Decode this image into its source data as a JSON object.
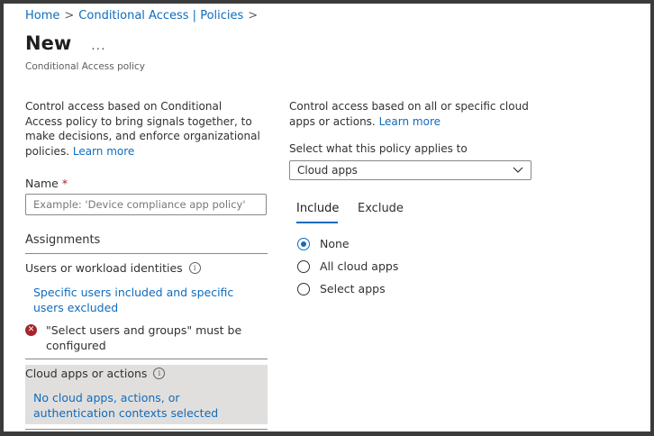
{
  "breadcrumb": {
    "home": "Home",
    "separator": ">",
    "section": "Conditional Access | Policies"
  },
  "header": {
    "title": "New",
    "more": "...",
    "subtitle": "Conditional Access policy"
  },
  "left": {
    "description": "Control access based on Conditional Access policy to bring signals together, to make decisions, and enforce organizational policies.",
    "learn_more": "Learn more",
    "name_label": "Name",
    "required_mark": "*",
    "name_placeholder": "Example: 'Device compliance app policy'",
    "name_value": "",
    "assignments_title": "Assignments",
    "users_label": "Users or workload identities",
    "users_link": "Specific users included and specific users excluded",
    "error_text": "\"Select users and groups\" must be configured",
    "cloud_label": "Cloud apps or actions",
    "cloud_link": "No cloud apps, actions, or authentication contexts selected"
  },
  "right": {
    "description": "Control access based on all or specific cloud apps or actions.",
    "learn_more": "Learn more",
    "applies_label": "Select what this policy applies to",
    "applies_value": "Cloud apps",
    "tabs": [
      {
        "label": "Include",
        "selected": true
      },
      {
        "label": "Exclude",
        "selected": false
      }
    ],
    "radios": [
      {
        "label": "None",
        "checked": true
      },
      {
        "label": "All cloud apps",
        "checked": false
      },
      {
        "label": "Select apps",
        "checked": false
      }
    ]
  },
  "icons": {
    "info": "info-icon",
    "error": "error-icon",
    "chevron": "chevron-down-icon"
  },
  "colors": {
    "link": "#0f6cbd",
    "error": "#a4262c",
    "selected_row": "#e1dfdd"
  }
}
